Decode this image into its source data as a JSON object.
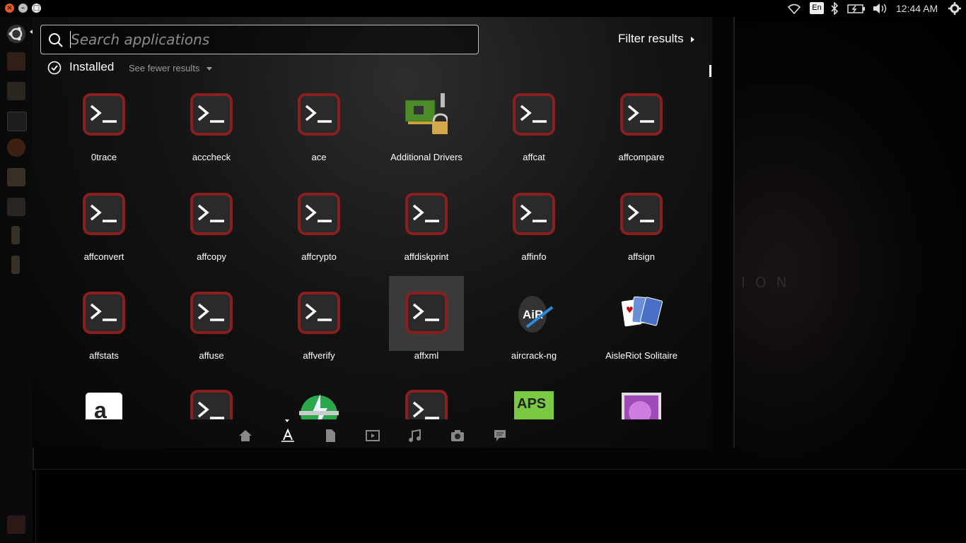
{
  "top_panel": {
    "clock": "12:44 AM",
    "keyboard_layout": "En",
    "icons": [
      "close-icon",
      "minimize-icon",
      "maximize-icon",
      "wifi-icon",
      "keyboard-icon",
      "bluetooth-icon",
      "battery-icon",
      "volume-icon",
      "session-gear-icon"
    ]
  },
  "search": {
    "placeholder": "Search applications",
    "value": ""
  },
  "filter": {
    "label": "Filter results"
  },
  "category": {
    "title": "Installed",
    "see_fewer": "See fewer results"
  },
  "apps": [
    {
      "name": "0trace",
      "icon": "terminal-icon"
    },
    {
      "name": "acccheck",
      "icon": "terminal-icon"
    },
    {
      "name": "ace",
      "icon": "terminal-icon"
    },
    {
      "name": "Additional Drivers",
      "icon": "drivers-icon"
    },
    {
      "name": "affcat",
      "icon": "terminal-icon"
    },
    {
      "name": "affcompare",
      "icon": "terminal-icon"
    },
    {
      "name": "affconvert",
      "icon": "terminal-icon"
    },
    {
      "name": "affcopy",
      "icon": "terminal-icon"
    },
    {
      "name": "affcrypto",
      "icon": "terminal-icon"
    },
    {
      "name": "affdiskprint",
      "icon": "terminal-icon"
    },
    {
      "name": "affinfo",
      "icon": "terminal-icon"
    },
    {
      "name": "affsign",
      "icon": "terminal-icon"
    },
    {
      "name": "affstats",
      "icon": "terminal-icon"
    },
    {
      "name": "affuse",
      "icon": "terminal-icon"
    },
    {
      "name": "affverify",
      "icon": "terminal-icon"
    },
    {
      "name": "affxml",
      "icon": "terminal-icon",
      "selected": true
    },
    {
      "name": "aircrack-ng",
      "icon": "aircrack-icon"
    },
    {
      "name": "AisleRiot Solitaire",
      "icon": "cards-icon"
    },
    {
      "name": "",
      "icon": "amazon-icon"
    },
    {
      "name": "",
      "icon": "terminal-icon"
    },
    {
      "name": "",
      "icon": "lightning-icon"
    },
    {
      "name": "",
      "icon": "terminal-icon"
    },
    {
      "name": "",
      "icon": "aps-icon"
    },
    {
      "name": "",
      "icon": "image-viewer-icon"
    }
  ],
  "lenses": [
    "home-lens-icon",
    "applications-lens-icon",
    "files-lens-icon",
    "video-lens-icon",
    "music-lens-icon",
    "photo-lens-icon",
    "social-lens-icon"
  ],
  "colors": {
    "terminal_border": "#8b1e1e",
    "terminal_bg": "#2a2a2a",
    "selection": "#3a3a3a"
  }
}
